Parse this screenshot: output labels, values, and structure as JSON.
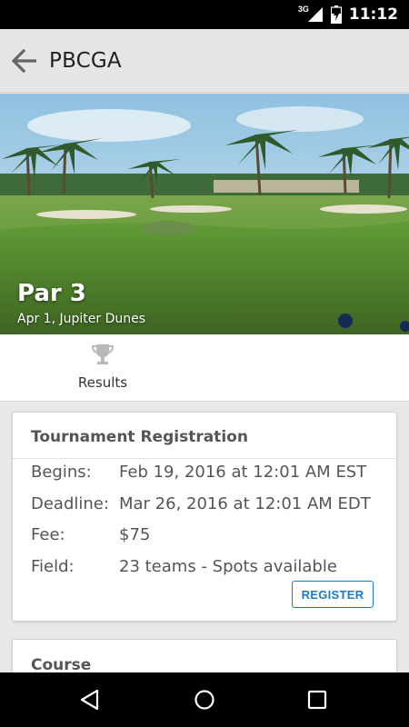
{
  "status_bar": {
    "network": "3G",
    "time": "11:12",
    "icons": [
      "signal-icon",
      "battery-icon"
    ]
  },
  "app_bar": {
    "title": "PBCGA",
    "back_icon": "arrow-left-icon"
  },
  "hero": {
    "title": "Par 3",
    "subtitle": "Apr 1, Jupiter Dunes"
  },
  "tabs": {
    "results_label": "Results",
    "results_icon": "trophy-icon"
  },
  "registration": {
    "title": "Tournament Registration",
    "rows": [
      {
        "label": "Begins:",
        "value": "Feb 19, 2016 at 12:01 AM EST"
      },
      {
        "label": "Deadline:",
        "value": "Mar 26, 2016 at 12:01 AM EDT"
      },
      {
        "label": "Fee:",
        "value": "$75"
      },
      {
        "label": "Field:",
        "value": "23 teams - Spots available"
      }
    ],
    "register_label": "REGISTER"
  },
  "course": {
    "title": "Course"
  },
  "nav_bar": {
    "icons": [
      "back-triangle-icon",
      "home-circle-icon",
      "recents-square-icon"
    ]
  },
  "colors": {
    "accent": "#1f7bc1",
    "app_bar": "#e6e6e6",
    "background": "#e8e8e8",
    "text_secondary": "#555555"
  }
}
